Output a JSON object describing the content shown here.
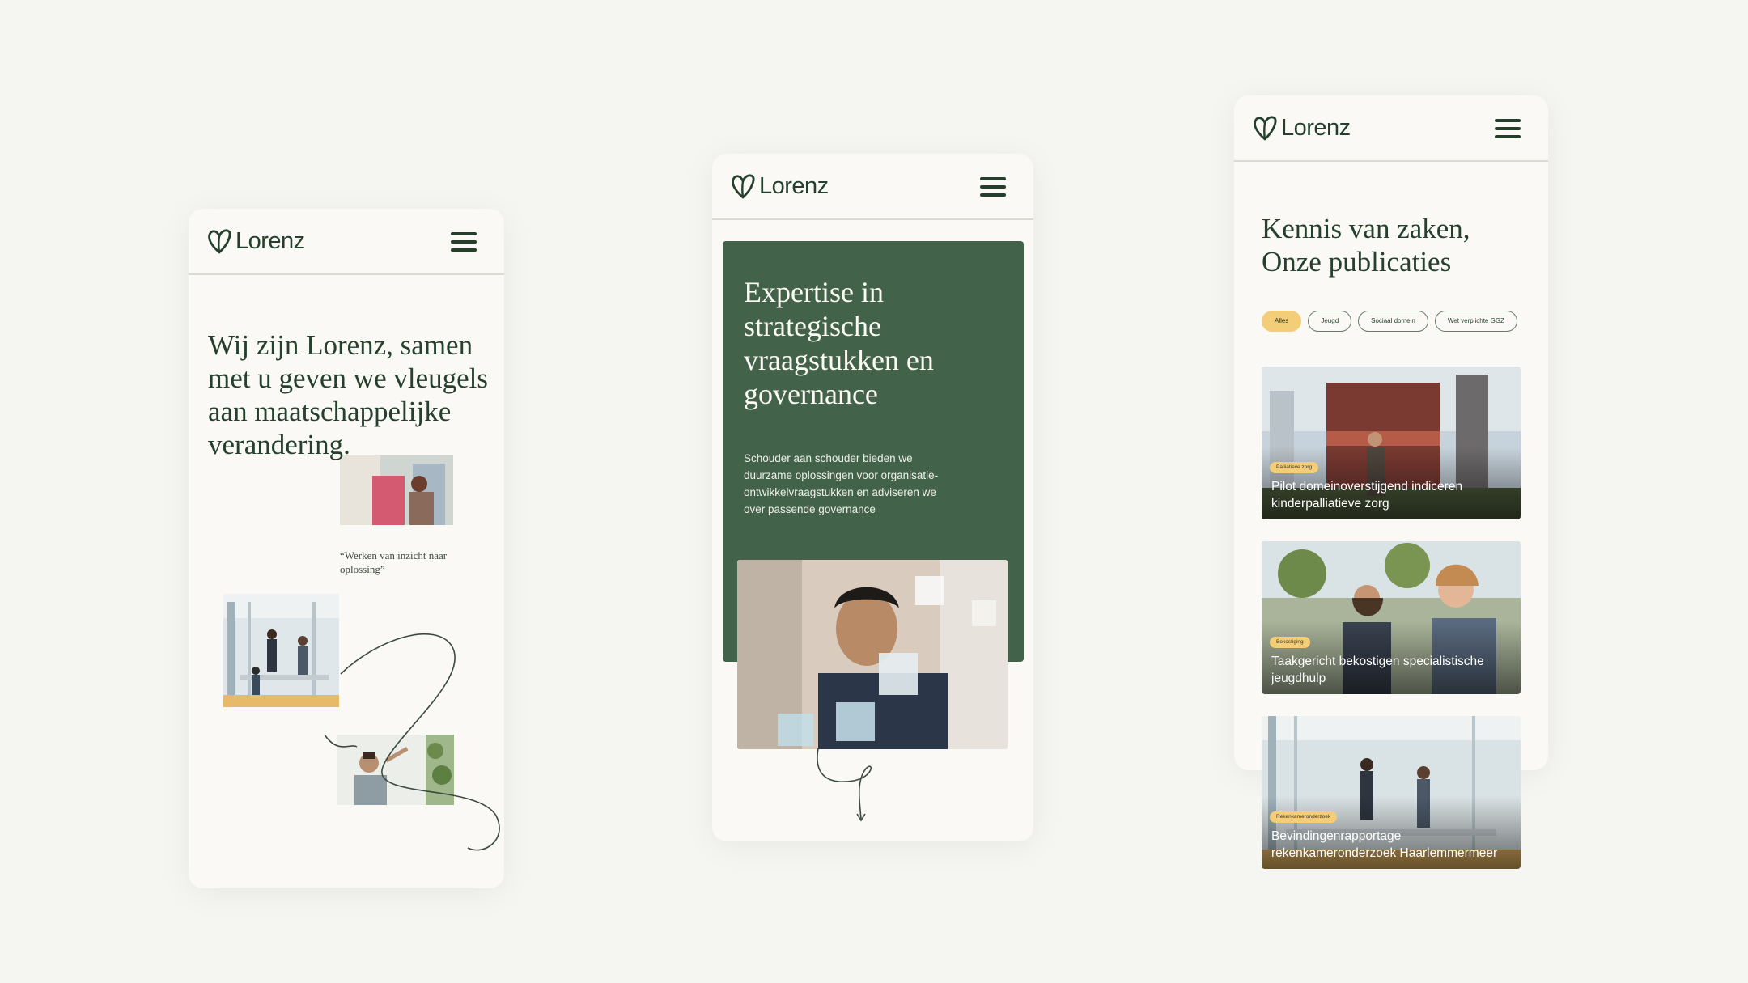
{
  "brand": {
    "name": "Lorenz"
  },
  "colors": {
    "primary_green": "#43624a",
    "dark_green": "#24402c",
    "accent_yellow": "#f4cd78",
    "background": "#faf9f5"
  },
  "phone1": {
    "hero_title": "Wij zijn Lorenz, samen met u geven we vleugels aan maatschappelijke verandering.",
    "quote": "“Werken van inzicht naar oplossing”"
  },
  "phone2": {
    "hero_title": "Expertise in strategische vraagstukken en governance",
    "hero_body": "Schouder aan schouder bieden we duurzame oplossingen voor organisatie-ontwikkelvraagstukken en adviseren we over passende governance"
  },
  "phone3": {
    "title_line1": "Kennis van zaken,",
    "title_line2": "Onze publicaties",
    "filters": [
      "Alles",
      "Jeugd",
      "Sociaal domein",
      "Wet verplichte GGZ"
    ],
    "active_filter": "Alles",
    "cards": [
      {
        "tag": "Palliatieve zorg",
        "title": "Pilot domeinoverstijgend indiceren kinderpalliatieve zorg"
      },
      {
        "tag": "Bekostiging",
        "title": "Taakgericht bekostigen specialistische jeugdhulp"
      },
      {
        "tag": "Rekenkameronderzoek",
        "title": "Bevindingenrapportage rekenkameronderzoek Haarlemmermeer"
      }
    ]
  },
  "icons": {
    "logo": "heart-leaf-icon",
    "menu": "hamburger-icon",
    "arrow": "arrow-down-icon"
  }
}
